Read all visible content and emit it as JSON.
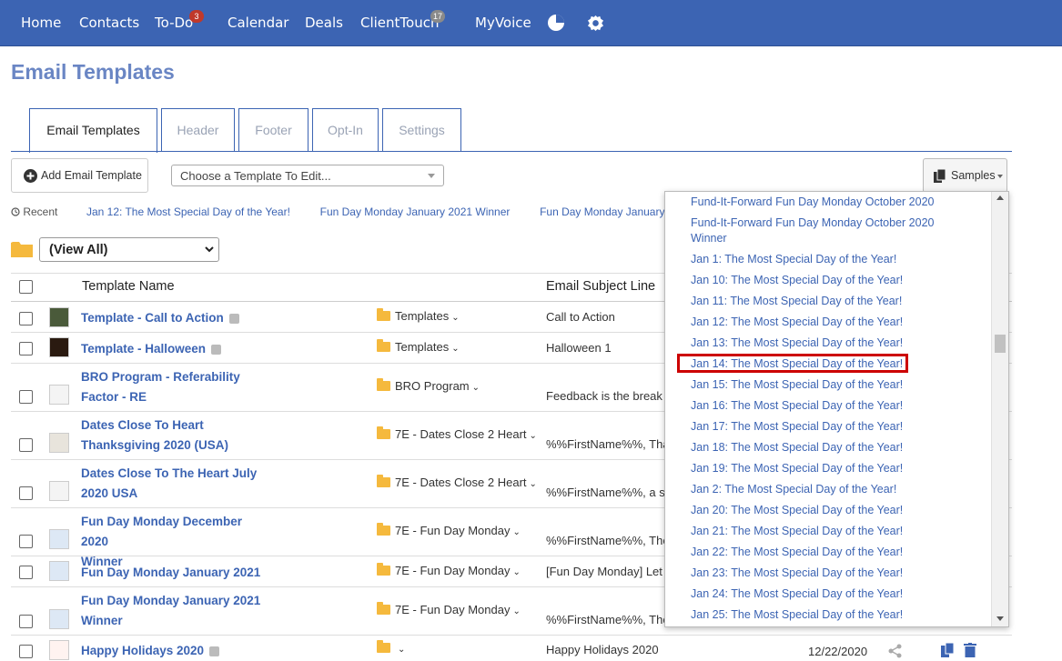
{
  "nav": {
    "home": "Home",
    "contacts": "Contacts",
    "todo": "To-Do",
    "todo_badge": "3",
    "calendar": "Calendar",
    "deals": "Deals",
    "clienttouch": "ClientTouch",
    "clienttouch_badge": "17",
    "myvoice": "MyVoice"
  },
  "page_title": "Email Templates",
  "tabs": [
    "Email Templates",
    "Header",
    "Footer",
    "Opt-In",
    "Settings"
  ],
  "toolbar": {
    "add_label": "Add Email Template",
    "choose_placeholder": "Choose a Template To Edit...",
    "samples_label": "Samples"
  },
  "recent": {
    "label": "Recent",
    "links": [
      "Jan 12: The Most Special Day of the Year!",
      "Fun Day Monday January 2021 Winner",
      "Fun Day Monday January"
    ]
  },
  "folder_filter": "(View All)",
  "table": {
    "headers": {
      "name": "Template Name",
      "subject": "Email Subject Line"
    },
    "rows": [
      {
        "name": "Template - Call to Action",
        "folder": "Templates",
        "subject": "Call to Action"
      },
      {
        "name": "Template - Halloween",
        "folder": "Templates",
        "subject": "Halloween 1"
      },
      {
        "name_line1": "BRO Program - Referability",
        "name_line2": "Factor - RE",
        "folder": "BRO Program",
        "subject": "Feedback is the break"
      },
      {
        "name_line1": "Dates Close To Heart",
        "name_line2": "Thanksgiving 2020 (USA)",
        "folder": "7E - Dates Close 2 Heart",
        "subject": "%%FirstName%%, Tha"
      },
      {
        "name_line1": "Dates Close To The Heart July",
        "name_line2": "2020 USA",
        "folder": "7E - Dates Close 2 Heart",
        "subject": "%%FirstName%%, a sp"
      },
      {
        "name_line1": "Fun Day Monday December 2020",
        "name_line2": "Winner",
        "folder": "7E - Fun Day Monday",
        "subject": "%%FirstName%%, The"
      },
      {
        "name": "Fun Day Monday January 2021",
        "folder": "7E - Fun Day Monday",
        "subject": "[Fun Day Monday] Let"
      },
      {
        "name_line1": "Fun Day Monday January 2021",
        "name_line2": "Winner",
        "folder": "7E - Fun Day Monday",
        "subject": "%%FirstName%%, The"
      },
      {
        "name": "Happy Holidays 2020",
        "folder": "",
        "subject": "Happy Holidays 2020",
        "date": "12/22/2020"
      }
    ]
  },
  "samples_dropdown": [
    "Fund-It-Forward Fun Day Monday October 2020",
    "Fund-It-Forward Fun Day Monday October 2020",
    "Winner",
    "Jan 1: The Most Special Day of the Year!",
    "Jan 10: The Most Special Day of the Year!",
    "Jan 11: The Most Special Day of the Year!",
    "Jan 12: The Most Special Day of the Year!",
    "Jan 13: The Most Special Day of the Year!",
    "Jan 14: The Most Special Day of the Year!",
    "Jan 15: The Most Special Day of the Year!",
    "Jan 16: The Most Special Day of the Year!",
    "Jan 17: The Most Special Day of the Year!",
    "Jan 18: The Most Special Day of the Year!",
    "Jan 19: The Most Special Day of the Year!",
    "Jan 2: The Most Special Day of the Year!",
    "Jan 20: The Most Special Day of the Year!",
    "Jan 21: The Most Special Day of the Year!",
    "Jan 22: The Most Special Day of the Year!",
    "Jan 23: The Most Special Day of the Year!",
    "Jan 24: The Most Special Day of the Year!",
    "Jan 25: The Most Special Day of the Year!"
  ],
  "colors": {
    "nav_bg": "#3c64b3",
    "link": "#3c64b3",
    "highlight": "#cc0000"
  }
}
